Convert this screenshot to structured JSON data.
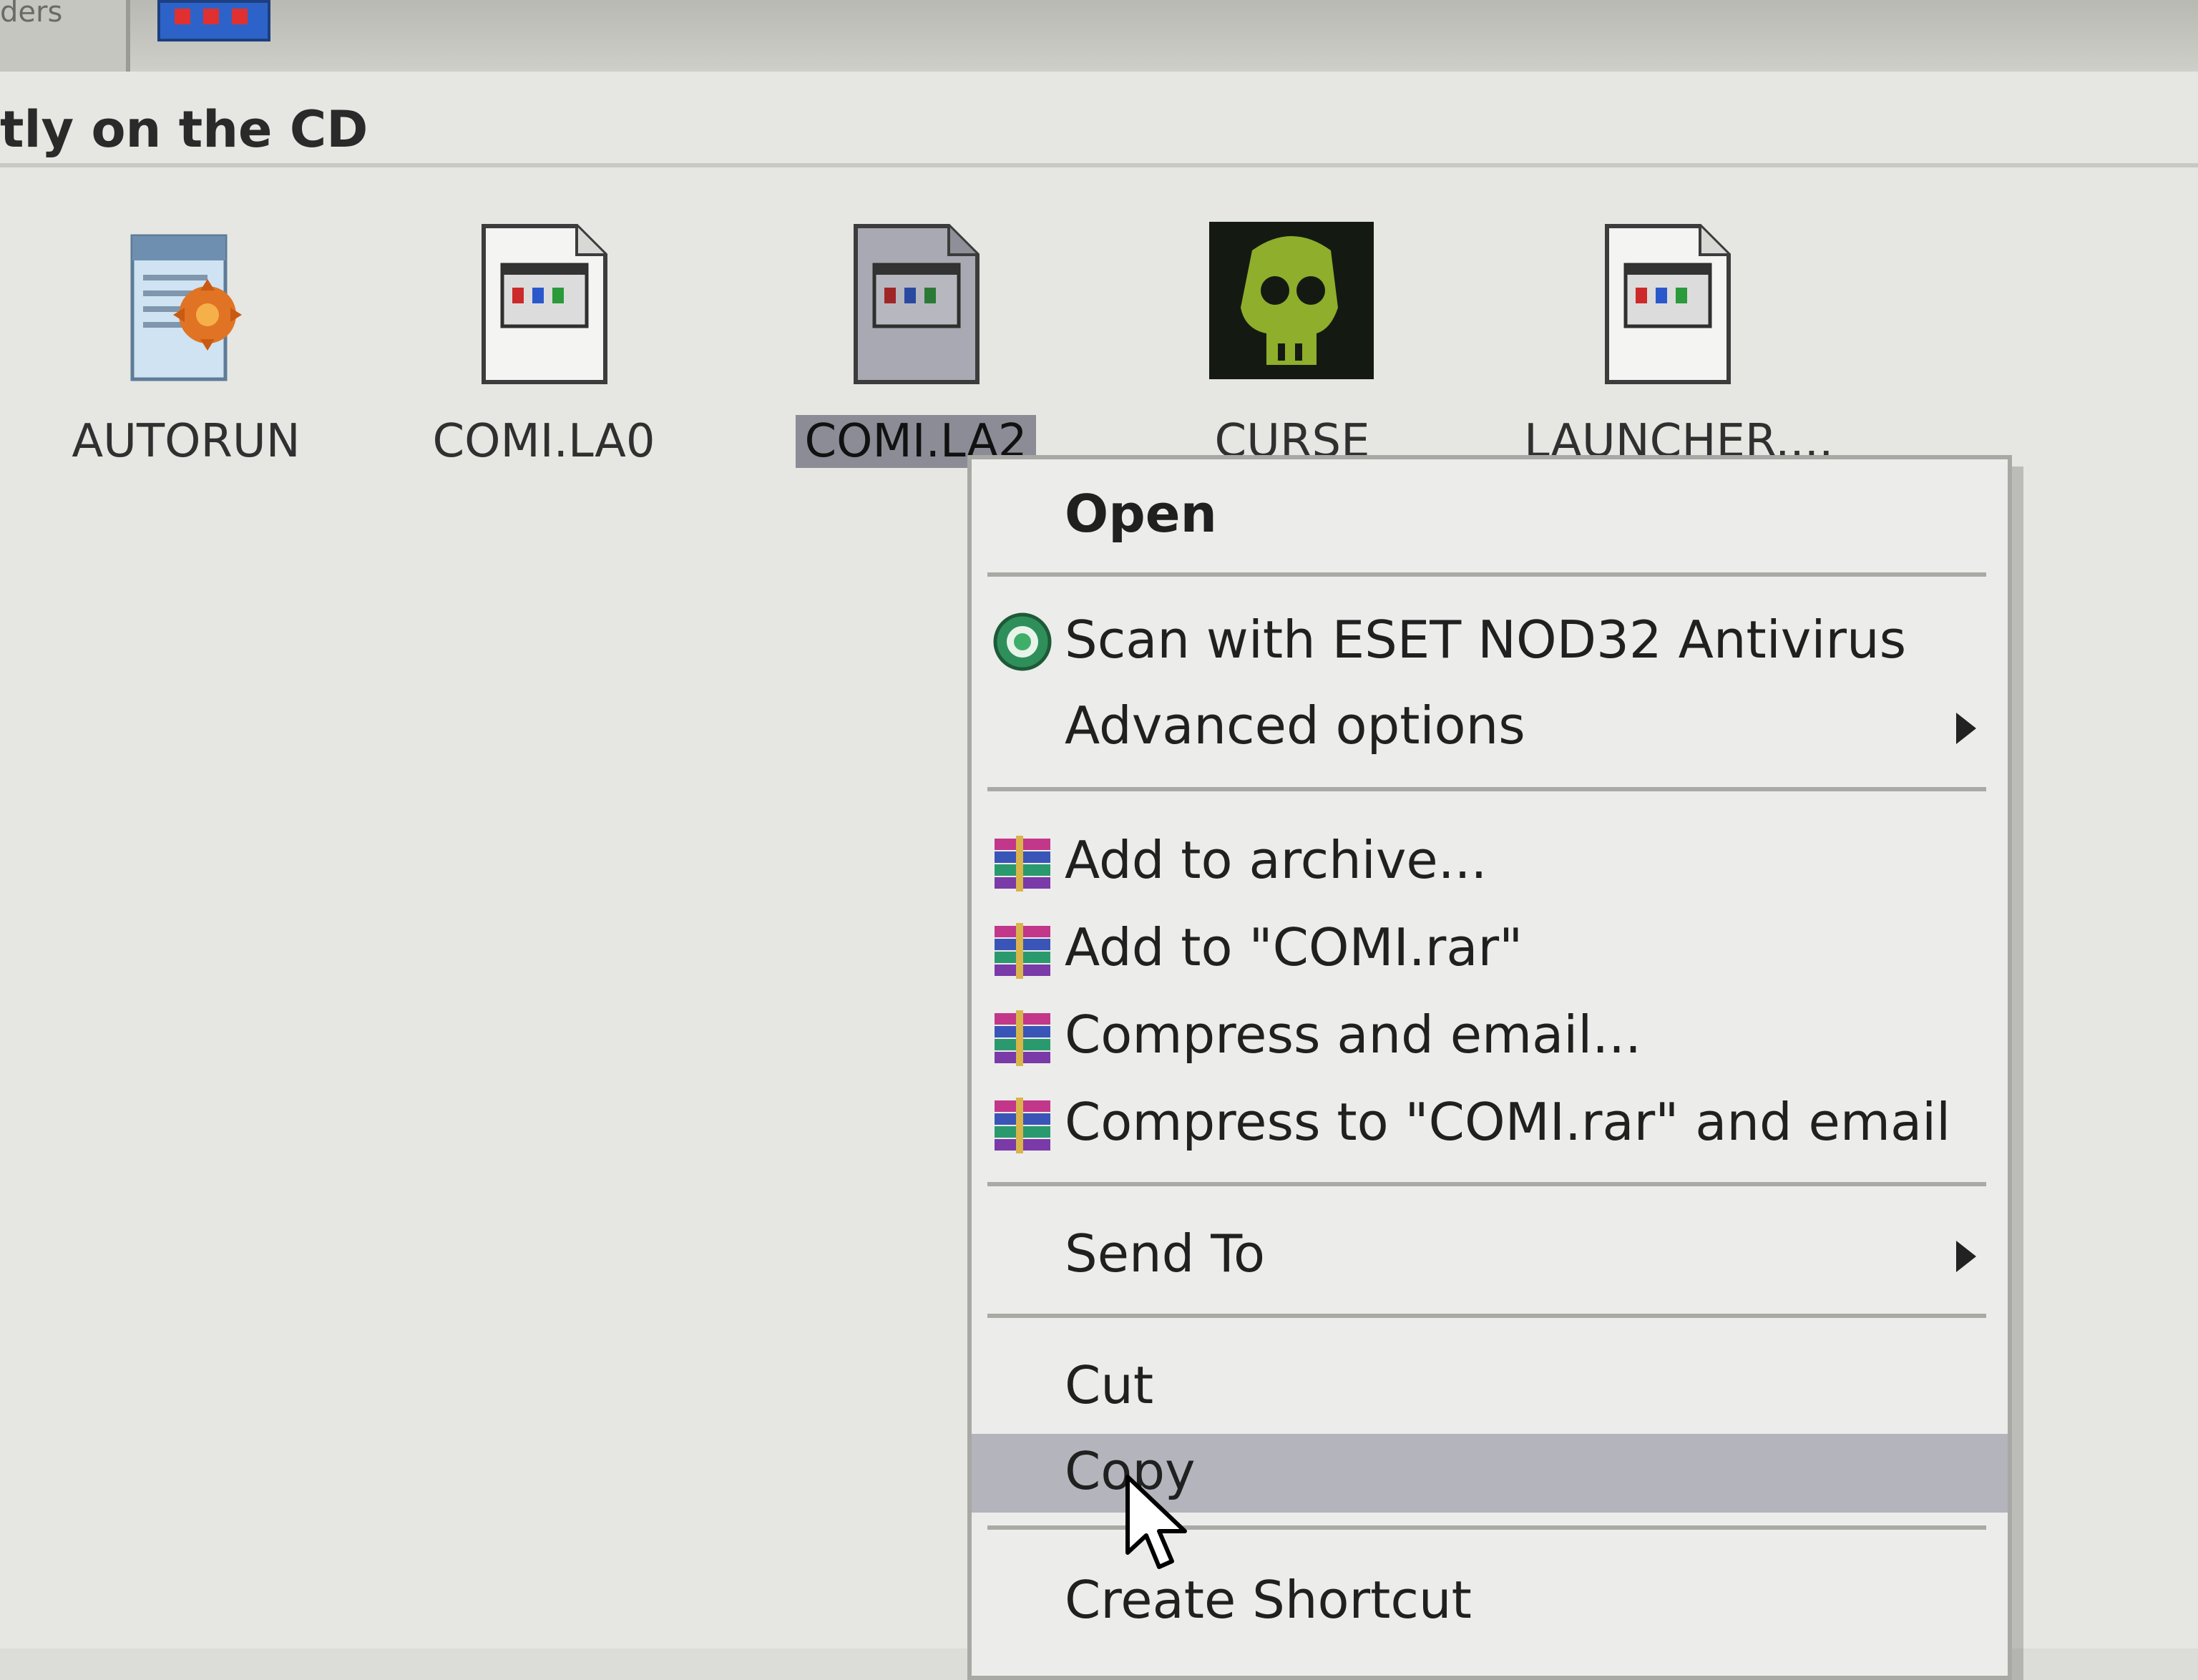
{
  "header": {
    "partial_label": "ders"
  },
  "section": {
    "title": "tly on the CD"
  },
  "files": [
    {
      "label": "AUTORUN",
      "icon": "autorun-setup-icon",
      "selected": false
    },
    {
      "label": "COMI.LA0",
      "icon": "application-file-icon",
      "selected": false
    },
    {
      "label": "COMI.LA2",
      "icon": "application-file-icon",
      "selected": true
    },
    {
      "label": "CURSE",
      "icon": "curse-skull-icon",
      "selected": false
    },
    {
      "label": "LAUNCHER....",
      "icon": "application-file-icon",
      "selected": false
    }
  ],
  "context_menu": {
    "open": "Open",
    "scan": "Scan with ESET NOD32 Antivirus",
    "advanced": "Advanced options",
    "add_archive": "Add to archive...",
    "add_rar": "Add to \"COMI.rar\"",
    "compress_email": "Compress and email...",
    "compress_rar_email": "Compress to \"COMI.rar\" and email",
    "send_to": "Send To",
    "cut": "Cut",
    "copy": "Copy",
    "create_shortcut": "Create Shortcut",
    "hovered_item": "Copy"
  },
  "colors": {
    "selection": "#8c8c96",
    "menu_hover": "#b4b4bc",
    "menu_bg": "#ececea"
  }
}
